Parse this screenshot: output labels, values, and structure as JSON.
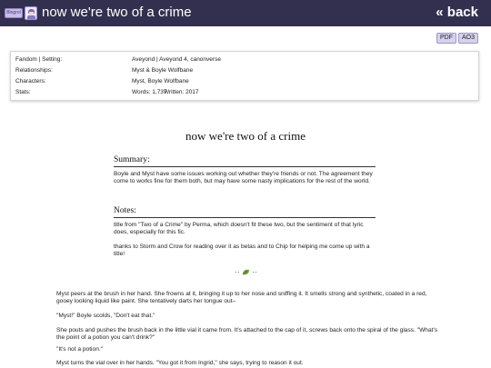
{
  "header": {
    "logo_badge_text": "Blogrol",
    "title": "now we're two of a crime",
    "back_label": "« back",
    "bar_color": "#33304f"
  },
  "downloads": {
    "pdf_label": "PDF",
    "ao3_label": "AO3"
  },
  "metadata": {
    "rows": [
      {
        "label": "Fandom | Setting:",
        "value": "Aveyond | Aveyond 4, canonverse"
      },
      {
        "label": "Relationships:",
        "value": "Myst & Boyle Wolfbane"
      },
      {
        "label": "Characters:",
        "value": "Myst, Boyle Wolfbane"
      },
      {
        "label": "Stats:",
        "value": "Words: 1,737",
        "value2": "Written: 2017"
      }
    ]
  },
  "work": {
    "title": "now we're two of a crime",
    "summary_heading": "Summary:",
    "summary_text": "Boyle and Myst have some issues working out whether they're friends or not. The agreement they come to works fine for them both, but may have some nasty implications for the rest of the world.",
    "notes_heading": "Notes:",
    "notes": [
      "title from \"Two of a Crime\" by Perma, which doesn't fit these two, but the sentiment of that lyric does, especially for this fic.",
      "thanks to Storm and Crow for reading over it as betas and to Chip for helping me come up with a title!"
    ],
    "divider_icon": "leaf-icon"
  },
  "story": {
    "paragraphs": [
      "Myst peers at the brush in her hand. She frowns at it, bringing it up to her nose and sniffing it. It smells strong and synthetic, coated in a red, gooey looking liquid like paint. She tentatively darts her tongue out–",
      "\"Myst!\" Boyle scolds, \"Don't eat that.\"",
      "She pouts and pushes the brush back in the little vial it came from. It's attached to the cap of it, screws back onto the spiral of the glass. \"What's the point of a potion you can't drink?\"",
      "\"It's not a potion.\"",
      "Myst turns the vial over in her hands. \"You got it from Ingrid,\" she says, trying to reason it out."
    ]
  }
}
